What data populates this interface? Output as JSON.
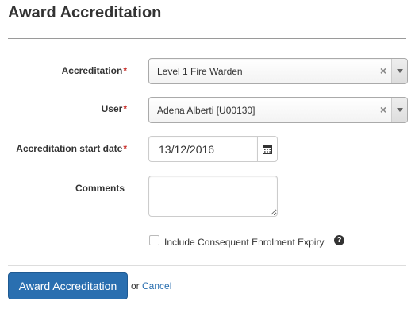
{
  "page": {
    "title": "Award Accreditation"
  },
  "form": {
    "accreditation": {
      "label": "Accreditation",
      "required_mark": "*",
      "value": "Level 1 Fire Warden",
      "clear_symbol": "×"
    },
    "user": {
      "label": "User",
      "required_mark": "*",
      "value": "Adena Alberti [U00130]",
      "clear_symbol": "×"
    },
    "start_date": {
      "label": "Accreditation start date",
      "required_mark": "*",
      "value": "13/12/2016",
      "icon": "calendar-icon"
    },
    "comments": {
      "label": "Comments",
      "value": ""
    },
    "include_expiry": {
      "label": "Include Consequent Enrolment Expiry",
      "checked": false,
      "help_symbol": "?"
    }
  },
  "actions": {
    "submit_label": "Award Accreditation",
    "or_text": "or",
    "cancel_label": "Cancel"
  },
  "colors": {
    "primary": "#2a6fb0",
    "required": "#c9302c",
    "text": "#333333"
  }
}
